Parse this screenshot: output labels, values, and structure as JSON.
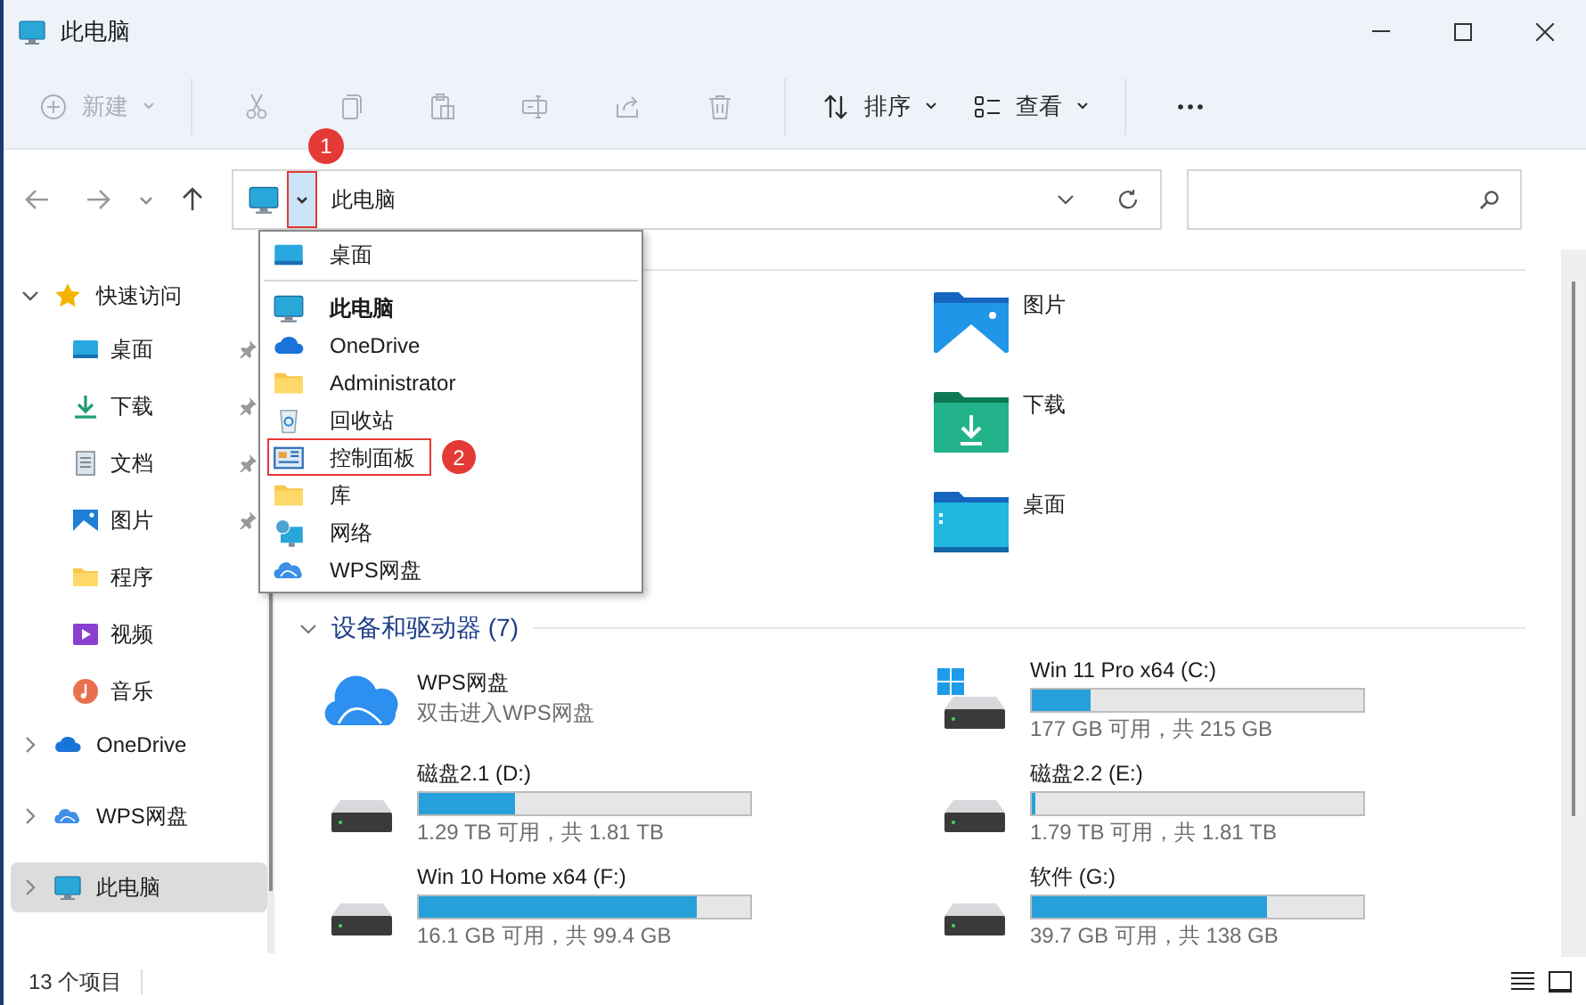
{
  "window": {
    "title": "此电脑"
  },
  "toolbar": [
    {
      "kind": "new",
      "label": "新建",
      "disabled": true,
      "caret": true
    },
    {
      "kind": "cut",
      "disabled": true
    },
    {
      "kind": "copy",
      "disabled": true
    },
    {
      "kind": "paste",
      "disabled": true
    },
    {
      "kind": "rename",
      "disabled": true
    },
    {
      "kind": "share",
      "disabled": true
    },
    {
      "kind": "delete",
      "disabled": true
    },
    {
      "kind": "sort",
      "label": "排序",
      "disabled": false,
      "caret": true
    },
    {
      "kind": "view",
      "label": "查看",
      "disabled": false,
      "caret": true
    },
    {
      "kind": "more",
      "disabled": false
    }
  ],
  "address": {
    "path": "此电脑",
    "annotation": "1"
  },
  "nav": [
    {
      "kind": "star",
      "label": "快速访问",
      "expanded": true,
      "selected": false,
      "children": [
        {
          "kind": "desktop",
          "label": "桌面",
          "pinned": true
        },
        {
          "kind": "download",
          "label": "下载",
          "pinned": true
        },
        {
          "kind": "document",
          "label": "文档",
          "pinned": true
        },
        {
          "kind": "pictures",
          "label": "图片",
          "pinned": true
        },
        {
          "kind": "folder",
          "label": "程序",
          "pinned": false
        },
        {
          "kind": "video",
          "label": "视频",
          "pinned": false
        },
        {
          "kind": "music",
          "label": "音乐",
          "pinned": false
        }
      ]
    },
    {
      "kind": "onedrive",
      "label": "OneDrive",
      "expanded": false,
      "selected": false
    },
    {
      "kind": "wps",
      "label": "WPS网盘",
      "expanded": false,
      "selected": false
    },
    {
      "kind": "pc",
      "label": "此电脑",
      "expanded": false,
      "selected": true
    }
  ],
  "dropdown": [
    {
      "kind": "desktop",
      "label": "桌面",
      "current": false,
      "separator_after": true
    },
    {
      "kind": "pc",
      "label": "此电脑",
      "current": true
    },
    {
      "kind": "onedrive",
      "label": "OneDrive",
      "current": false
    },
    {
      "kind": "folder",
      "label": "Administrator",
      "current": false
    },
    {
      "kind": "recycle",
      "label": "回收站",
      "current": false
    },
    {
      "kind": "control",
      "label": "控制面板",
      "current": false,
      "annotation": "2"
    },
    {
      "kind": "folder",
      "label": "库",
      "current": false
    },
    {
      "kind": "network",
      "label": "网络",
      "current": false
    },
    {
      "kind": "wps",
      "label": "WPS网盘",
      "current": false
    }
  ],
  "folders": [
    {
      "kind": "pictures",
      "label": "图片"
    },
    {
      "kind": "download",
      "label": "下载"
    },
    {
      "kind": "desktop",
      "label": "桌面"
    }
  ],
  "drives_section": {
    "title": "设备和驱动器 (7)",
    "expanded": true
  },
  "drives": [
    {
      "kind": "cloud",
      "name": "WPS网盘",
      "subtitle": "双击进入WPS网盘"
    },
    {
      "kind": "system",
      "name": "Win 11 Pro x64 (C:)",
      "level": 0.18,
      "reading": "177 GB 可用，共 215 GB"
    },
    {
      "kind": "disk",
      "name": "磁盘2.1 (D:)",
      "level": 0.29,
      "reading": "1.29 TB 可用，共 1.81 TB"
    },
    {
      "kind": "disk",
      "name": "磁盘2.2 (E:)",
      "level": 0.01,
      "reading": "1.79 TB 可用，共 1.81 TB"
    },
    {
      "kind": "disk",
      "name": "Win 10 Home x64 (F:)",
      "level": 0.84,
      "reading": "16.1 GB 可用，共 99.4 GB"
    },
    {
      "kind": "disk",
      "name": "软件 (G:)",
      "level": 0.71,
      "reading": "39.7 GB 可用，共 138 GB"
    }
  ],
  "status_bar": {
    "count": "13 个项目"
  }
}
